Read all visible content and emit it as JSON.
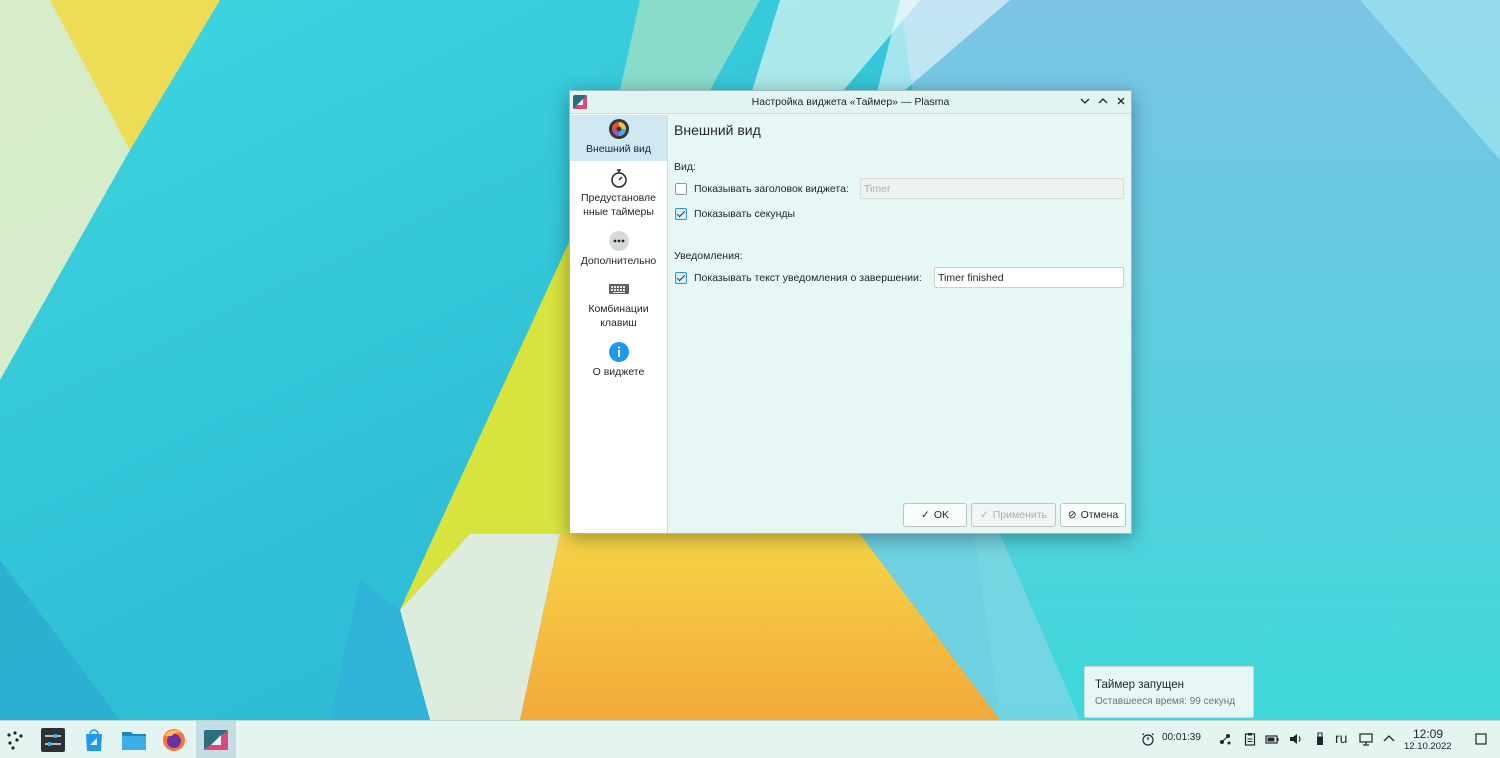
{
  "dialog": {
    "title": "Настройка виджета «Таймер» — Plasma",
    "sidebar": [
      {
        "label": "Внешний вид",
        "icon": "appearance-icon",
        "active": true
      },
      {
        "label": "Предустановле нные таймеры",
        "icon": "stopwatch-icon",
        "active": false
      },
      {
        "label": "Дополнительно",
        "icon": "more-icon",
        "active": false
      },
      {
        "label": "Комбинации клавиш",
        "icon": "keyboard-icon",
        "active": false
      },
      {
        "label": "О виджете",
        "icon": "info-icon",
        "active": false
      }
    ],
    "page_title": "Внешний вид",
    "view_group": "Вид:",
    "show_title_label": "Показывать заголовок виджета:",
    "show_title_checked": false,
    "title_placeholder": "Timer",
    "show_seconds_label": "Показывать секунды",
    "show_seconds_checked": true,
    "notifications_group": "Уведомления:",
    "show_notif_label": "Показывать текст уведомления о завершении:",
    "show_notif_checked": true,
    "notif_text": "Timer finished",
    "buttons": {
      "ok": "OK",
      "apply": "Применить",
      "cancel": "Отмена"
    }
  },
  "notification": {
    "title": "Таймер запущен",
    "body": "Оставшееся время: 99 секунд"
  },
  "taskbar": {
    "apps": [
      "app-launcher-icon",
      "system-settings-icon",
      "discover-icon",
      "file-manager-icon",
      "firefox-icon",
      "plasma-settings-icon"
    ],
    "timer": "00:01:39",
    "layout": "ru",
    "time": "12:09",
    "date": "12.10.2022"
  },
  "colors": {
    "accent": "#3daee9",
    "dialog_bg": "#e7f7f5",
    "taskbar_bg": "#e3f4f1"
  }
}
